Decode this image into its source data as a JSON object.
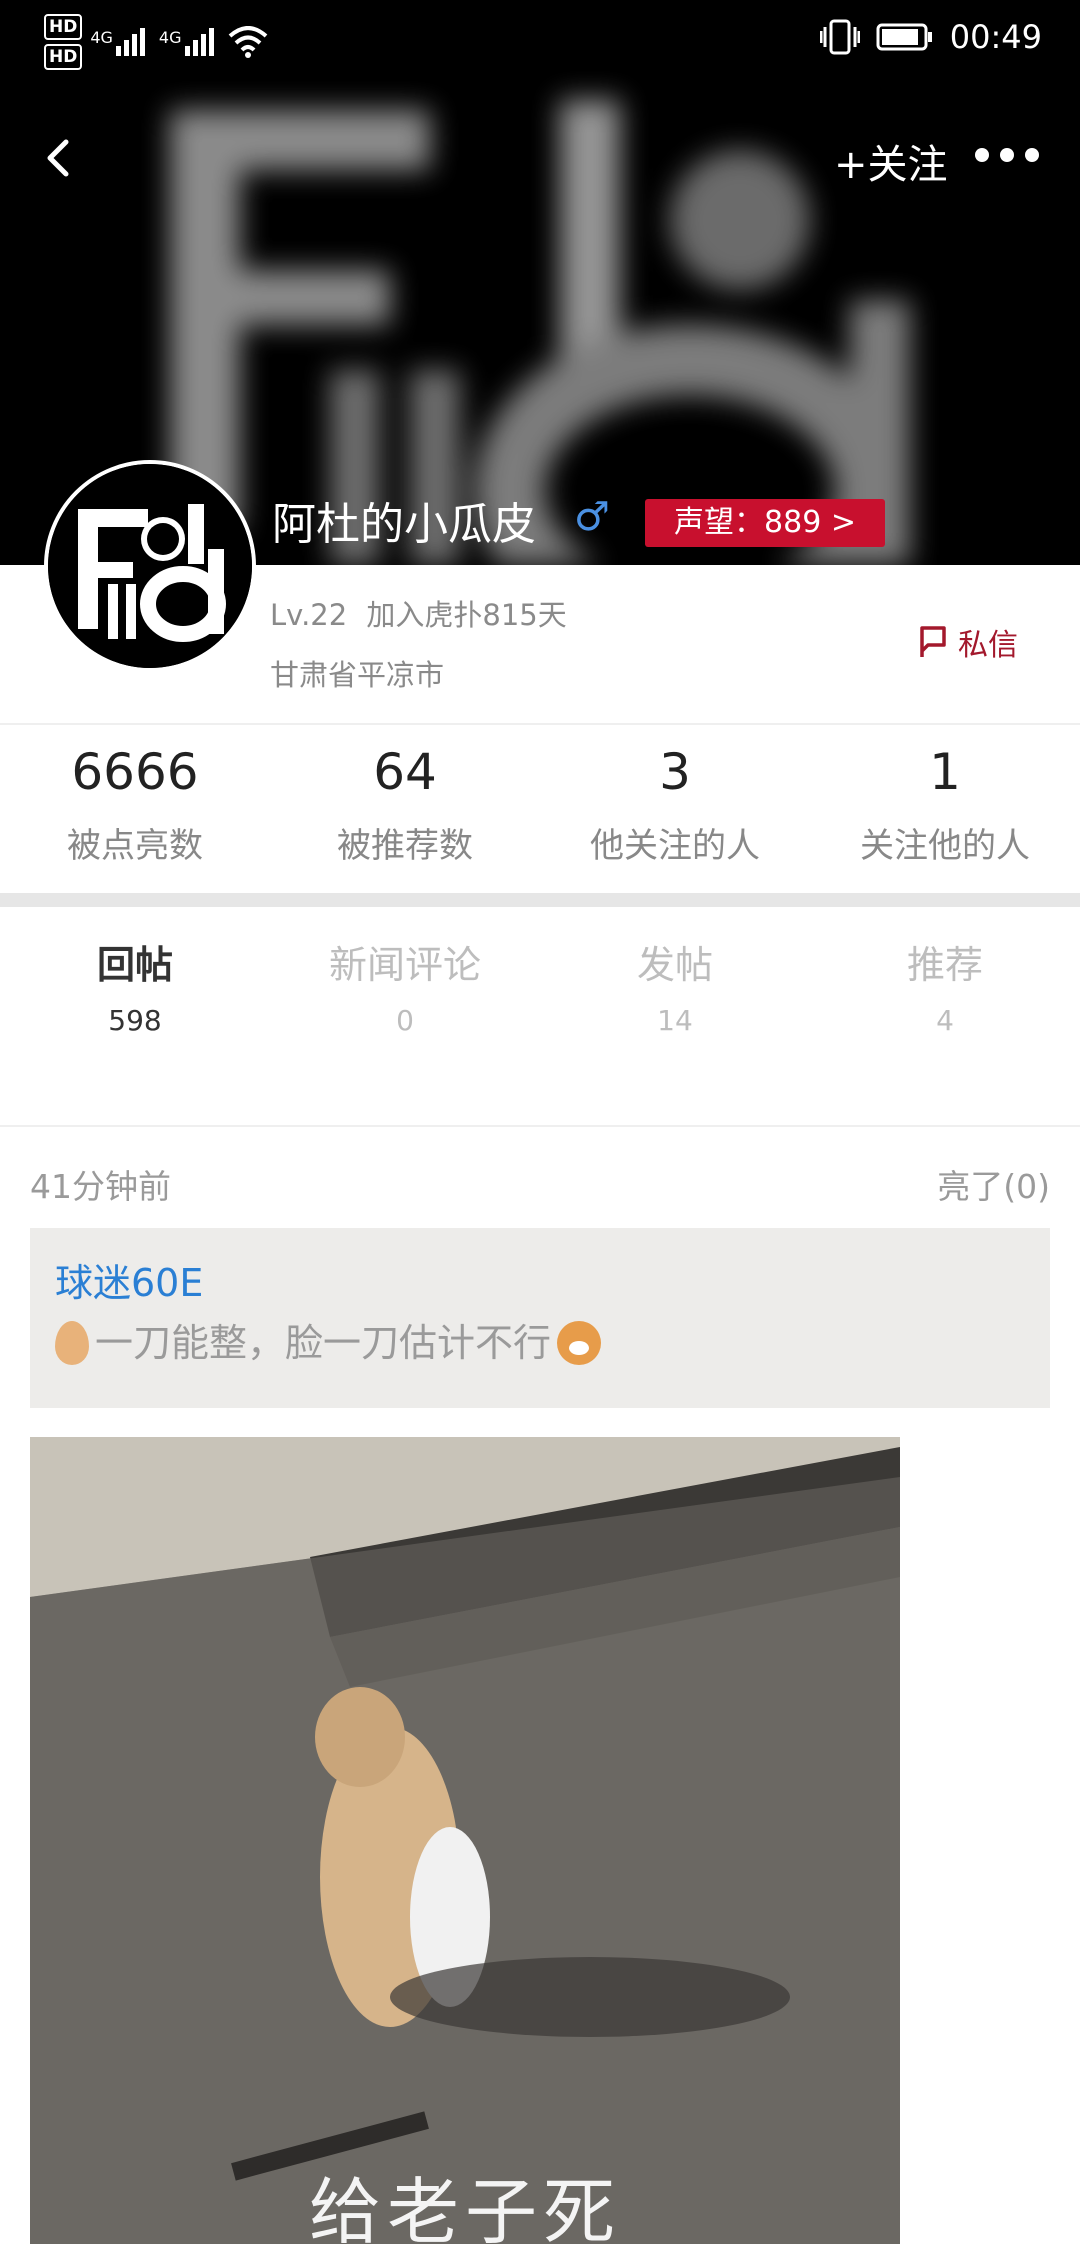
{
  "status_bar": {
    "time": "00:49",
    "sim1": "HD",
    "sim2": "HD",
    "net1": "4G",
    "net2": "4G"
  },
  "nav": {
    "follow_label": "+关注"
  },
  "profile": {
    "username": "阿杜的小瓜皮",
    "gender_symbol": "♂",
    "reputation": "声望：889 >",
    "level": "Lv.22",
    "joined": "加入虎扑815天",
    "location": "甘肃省平凉市",
    "message_label": "私信"
  },
  "stats": [
    {
      "value": "6666",
      "label": "被点亮数"
    },
    {
      "value": "64",
      "label": "被推荐数"
    },
    {
      "value": "3",
      "label": "他关注的人"
    },
    {
      "value": "1",
      "label": "关注他的人"
    }
  ],
  "tabs": [
    {
      "label": "回帖",
      "count": "598",
      "active": true
    },
    {
      "label": "新闻评论",
      "count": "0",
      "active": false
    },
    {
      "label": "发帖",
      "count": "14",
      "active": false
    },
    {
      "label": "推荐",
      "count": "4",
      "active": false
    }
  ],
  "post": {
    "time": "41分钟前",
    "likes": "亮了(0)",
    "quote_user": "球迷60E",
    "quote_text": "一刀能整，脸一刀估计不行",
    "image_caption": "给老子死"
  },
  "colors": {
    "accent": "#c8102e",
    "link": "#2a7fd4",
    "gender": "#4a90e2"
  }
}
